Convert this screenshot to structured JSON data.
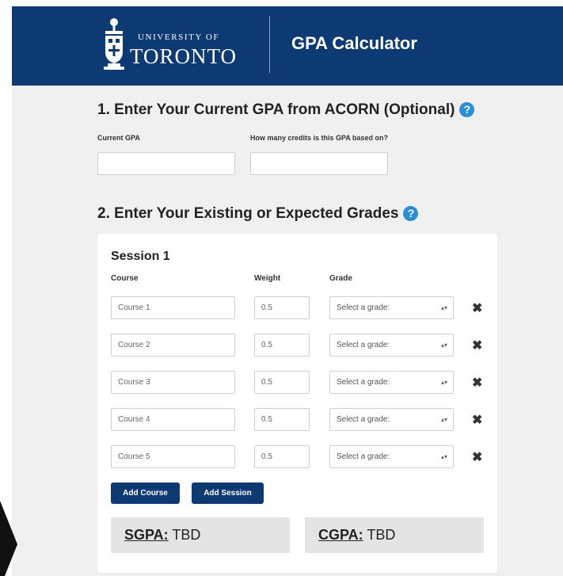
{
  "header": {
    "university_small": "UNIVERSITY OF",
    "university_big": "TORONTO",
    "app_title": "GPA Calculator",
    "crest_icon": "university-crest-icon",
    "color": "#0d3a72"
  },
  "section1": {
    "heading": "1. Enter Your Current GPA from ACORN (Optional)",
    "help_icon": "?",
    "current_gpa_label": "Current GPA",
    "current_gpa_value": "",
    "credits_label": "How many credits is this GPA based on?",
    "credits_value": ""
  },
  "section2": {
    "heading": "2. Enter Your Existing or Expected Grades",
    "help_icon": "?"
  },
  "session": {
    "title": "Session 1",
    "columns": {
      "course": "Course",
      "weight": "Weight",
      "grade": "Grade"
    },
    "rows": [
      {
        "course": "Course 1",
        "weight": "0.5",
        "grade": "Select a grade:"
      },
      {
        "course": "Course 2",
        "weight": "0.5",
        "grade": "Select a grade:"
      },
      {
        "course": "Course 3",
        "weight": "0.5",
        "grade": "Select a grade:"
      },
      {
        "course": "Course 4",
        "weight": "0.5",
        "grade": "Select a grade:"
      },
      {
        "course": "Course 5",
        "weight": "0.5",
        "grade": "Select a grade:"
      }
    ],
    "remove_glyph": "✖",
    "select_arrows": "▴▾",
    "add_course_label": "Add Course",
    "add_session_label": "Add Session",
    "sgpa_key": "SGPA:",
    "sgpa_value": "TBD",
    "cgpa_key": "CGPA:",
    "cgpa_value": "TBD"
  }
}
